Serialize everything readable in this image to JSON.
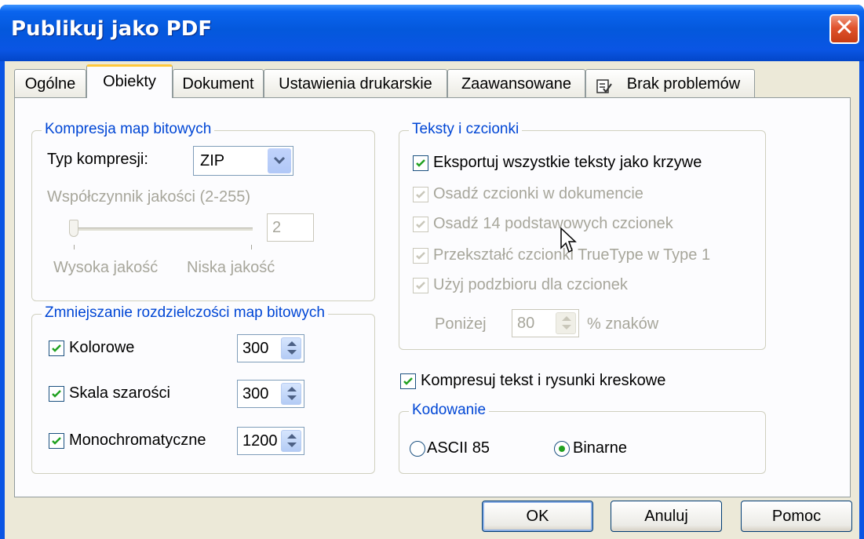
{
  "window": {
    "title": "Publikuj jako PDF",
    "close_symbol": "✕"
  },
  "tabs": [
    {
      "label": "Ogólne"
    },
    {
      "label": "Obiekty"
    },
    {
      "label": "Dokument"
    },
    {
      "label": "Ustawienia drukarskie"
    },
    {
      "label": "Zaawansowane"
    },
    {
      "label": "Brak problemów",
      "icon": "checklist-icon"
    }
  ],
  "active_tab": "Obiekty",
  "compression": {
    "title": "Kompresja map bitowych",
    "type_label": "Typ kompresji:",
    "type_value": "ZIP",
    "quality_label": "Współczynnik jakości (2-255)",
    "quality_value": "2",
    "high_label": "Wysoka jakość",
    "low_label": "Niska jakość"
  },
  "downsample": {
    "title": "Zmniejszanie rozdzielczości map bitowych",
    "items": [
      {
        "label": "Kolorowe",
        "checked": true,
        "value": "300"
      },
      {
        "label": "Skala szarości",
        "checked": true,
        "value": "300"
      },
      {
        "label": "Monochromatyczne",
        "checked": true,
        "value": "1200"
      }
    ]
  },
  "fonts": {
    "title": "Teksty i czcionki",
    "items": [
      {
        "label": "Eksportuj wszystkie teksty jako krzywe",
        "checked": true,
        "enabled": true
      },
      {
        "label": "Osadź czcionki w dokumencie",
        "checked": true,
        "enabled": false
      },
      {
        "label": "Osadź 14 podstawowych czcionek",
        "checked": true,
        "enabled": false
      },
      {
        "label": "Przekształć czcionki TrueType w Type 1",
        "checked": true,
        "enabled": false
      },
      {
        "label": "Użyj podzbioru dla czcionek",
        "checked": true,
        "enabled": false
      }
    ],
    "below_label": "Poniżej",
    "below_value": "80",
    "percent_label": "% znaków"
  },
  "compress_text": {
    "label": "Kompresuj tekst i rysunki kreskowe",
    "checked": true
  },
  "encoding": {
    "title": "Kodowanie",
    "options": [
      {
        "label": "ASCII 85",
        "selected": false
      },
      {
        "label": "Binarne",
        "selected": true
      }
    ]
  },
  "buttons": {
    "ok": "OK",
    "cancel": "Anuluj",
    "help": "Pomoc"
  }
}
